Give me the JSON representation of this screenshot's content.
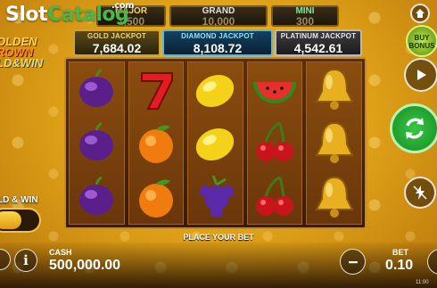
{
  "watermark": {
    "slot": "Slot",
    "catalog": "Catalog",
    "com": ".com"
  },
  "top_jackpots": {
    "major": {
      "label": "MAJOR",
      "value": "1,500"
    },
    "grand": {
      "label": "GRAND",
      "value": "10,000"
    },
    "mini": {
      "label": "MINI",
      "value": "300"
    }
  },
  "jackpots": {
    "gold": {
      "label": "GOLD JACKPOT",
      "value": "7,684.02"
    },
    "diamond": {
      "label": "DIAMOND JACKPOT",
      "value": "8,108.72"
    },
    "platinum": {
      "label": "PLATINUM JACKPOT",
      "value": "4,542.61"
    }
  },
  "logo": {
    "line1": "OLDEN",
    "line2": "ROWN",
    "line3": "LD&WIN"
  },
  "reels": [
    [
      "plum-icon",
      "plum-icon",
      "plum-icon"
    ],
    [
      "seven-icon",
      "orange-icon",
      "orange-icon"
    ],
    [
      "lemon-icon",
      "lemon-icon",
      "grapes-icon"
    ],
    [
      "watermelon-icon",
      "cherries-icon",
      "cherries-icon"
    ],
    [
      "bell-icon",
      "bell-icon",
      "bell-icon"
    ]
  ],
  "message": "PLACE YOUR BET",
  "buy_bonus": {
    "line1": "BUY",
    "line2": "BONUS"
  },
  "hold_and_win": {
    "label": "LD & WIN",
    "enabled": true
  },
  "cash": {
    "label": "CASH",
    "value": "500,000.00"
  },
  "bet": {
    "label": "BET",
    "value": "0.10"
  },
  "clock": "11:00",
  "colors": {
    "accent": "#f0c24a",
    "spin": "#2fbf3a",
    "buy_bonus": "#8bc82a"
  }
}
